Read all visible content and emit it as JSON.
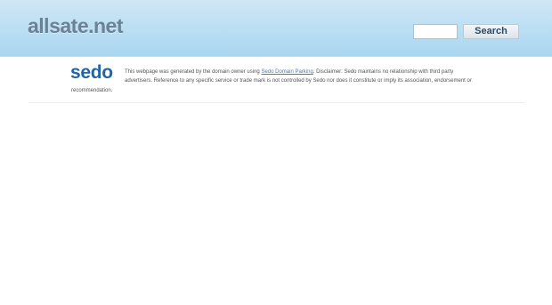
{
  "header": {
    "site_title": "allsate.net",
    "search_input_value": "",
    "search_button_label": "Search"
  },
  "disclaimer": {
    "logo_text": "sedo",
    "line1_prefix": "This webpage was generated by the domain owner using ",
    "link_text": "Sedo Domain Parking",
    "line1_suffix": ". Disclaimer: Sedo maintains no relationship with third party",
    "line2": "advertisers. Reference to any specific service or trade mark is not controlled by Sedo nor does it constitute or imply its association, endorsement or",
    "line3": "recommendation."
  },
  "colors": {
    "header_gradient_top": "#cfe7f6",
    "header_gradient_bottom": "#a9d6f0",
    "title_color": "#6b8294",
    "sedo_blue": "#1e66a8",
    "link_color": "#4a7fb0"
  },
  "icons": {
    "logo": "sedo-logo"
  }
}
